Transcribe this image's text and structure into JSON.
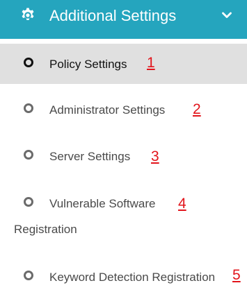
{
  "header": {
    "title": "Additional Settings",
    "icon": "gear-icon",
    "toggle_icon": "chevron-down-icon",
    "background_color": "#25a5be",
    "text_color": "#ffffff"
  },
  "menu": {
    "items": [
      {
        "label": "Policy Settings",
        "marker": "1",
        "active": true
      },
      {
        "label": "Administrator Settings",
        "marker": "2",
        "active": false
      },
      {
        "label": "Server Settings",
        "marker": "3",
        "active": false
      },
      {
        "label": "Vulnerable Software",
        "label_continued": "Registration",
        "marker": "4",
        "active": false
      },
      {
        "label": "Keyword Detection Registration",
        "marker": "5",
        "active": false
      }
    ],
    "active_background": "#e0e0e0",
    "marker_color": "#e2141b"
  }
}
